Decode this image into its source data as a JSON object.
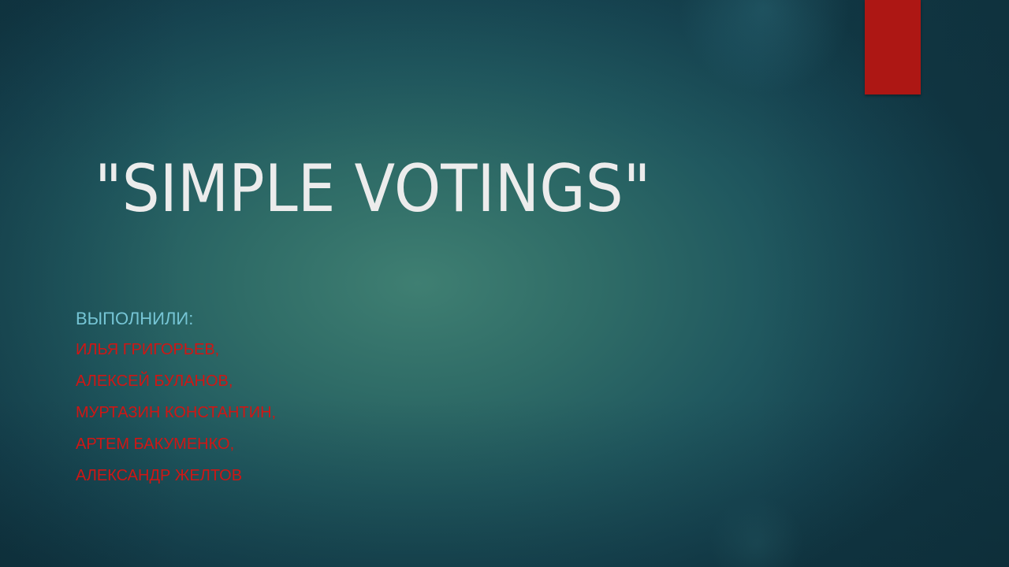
{
  "slide": {
    "title": "\"SIMPLE VOTINGS\"",
    "authors_label": "ВЫПОЛНИЛИ:",
    "authors": [
      "ИЛЬЯ ГРИГОРЬЕВ,",
      "АЛЕКСЕЙ БУЛАНОВ,",
      "МУРТАЗИН КОНСТАНТИН,",
      "АРТЕМ БАКУМЕНКО,",
      "АЛЕКСАНДР ЖЕЛТОВ"
    ]
  },
  "colors": {
    "background_center": "#3f7f72",
    "background_edge": "#123a47",
    "title": "#ececec",
    "authors_label": "#76c5d5",
    "author_names": "#d01614",
    "accent_bar": "#ad1714"
  }
}
